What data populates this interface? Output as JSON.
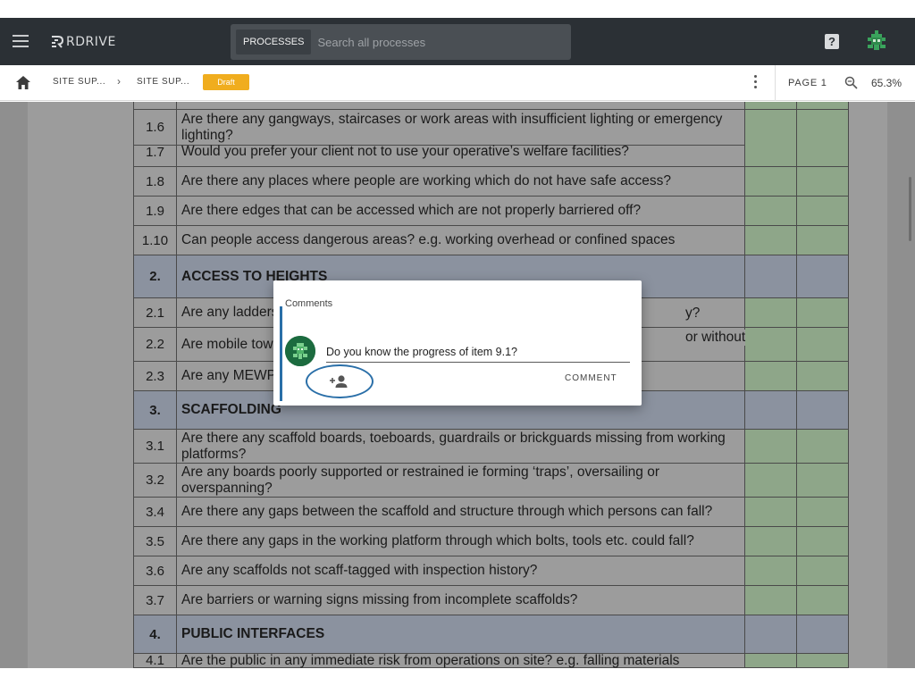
{
  "app": {
    "logo_text": "RDRIVE",
    "search": {
      "button_label": "PROCESSES",
      "placeholder": "Search all processes"
    },
    "help_label": "?"
  },
  "toolbar": {
    "breadcrumbs": [
      "SITE SUP...",
      "SITE SUP..."
    ],
    "separator": "›",
    "status_badge": "Draft",
    "page_label": "PAGE 1",
    "zoom": "65.3%"
  },
  "document": {
    "rows": [
      {
        "num": "",
        "text": "",
        "section": false
      },
      {
        "num": "1.6",
        "text": "Are there any gangways, staircases or work areas with insufficient lighting or emergency lighting?",
        "section": false
      },
      {
        "num": "1.7",
        "text": "Would you prefer your client not to use your operative’s welfare facilities?",
        "section": false
      },
      {
        "num": "1.8",
        "text": "Are there any places where people are working which do not have safe access?",
        "section": false
      },
      {
        "num": "1.9",
        "text": "Are there edges that can be accessed which are not properly barriered off?",
        "section": false
      },
      {
        "num": "1.10",
        "text": "Can people access dangerous areas? e.g. working overhead or confined spaces",
        "section": false
      },
      {
        "num": "2.",
        "text": "ACCESS TO HEIGHTS",
        "section": true
      },
      {
        "num": "2.1",
        "text": "Are any ladders to",
        "section": false
      },
      {
        "num": "2.2",
        "text": "Are mobile towers outriggers",
        "section": false
      },
      {
        "num": "2.3",
        "text": "Are any MEWP op",
        "section": false
      },
      {
        "num": "3.",
        "text": "SCAFFOLDING",
        "section": true
      },
      {
        "num": "3.1",
        "text": "Are there any scaffold boards, toeboards, guardrails or brickguards missing from working platforms?",
        "section": false
      },
      {
        "num": "3.2",
        "text": "Are any boards poorly supported or restrained ie forming ‘traps’, oversailing or overspanning?",
        "section": false
      },
      {
        "num": "3.4",
        "text": "Are there any gaps between the scaffold and structure through which persons can fall?",
        "section": false
      },
      {
        "num": "3.5",
        "text": "Are there any gaps in the working platform through which bolts, tools etc. could fall?",
        "section": false
      },
      {
        "num": "3.6",
        "text": "Are any scaffolds not scaff-tagged with inspection history?",
        "section": false
      },
      {
        "num": "3.7",
        "text": "Are barriers or warning signs missing from incomplete scaffolds?",
        "section": false
      },
      {
        "num": "4.",
        "text": "PUBLIC INTERFACES",
        "section": true
      },
      {
        "num": "4.1",
        "text": "Are the public in any immediate risk from operations on site? e.g. falling materials",
        "section": false
      }
    ],
    "partial_right_text": {
      "row_2_1": "y?",
      "row_2_2": "or without"
    }
  },
  "comments_dialog": {
    "title": "Comments",
    "comment_value": "Do you know the progress of item 9.1?",
    "submit_label": "COMMENT"
  },
  "colors": {
    "appbar": "#2b3035",
    "accent_blue": "#2a6fa8",
    "draft_badge": "#f0ad1e",
    "checkbox_green": "#8ea689",
    "section_gray": "#8b929f"
  },
  "icons": [
    "menu-icon",
    "logo-icon",
    "help-icon",
    "avatar-icon",
    "home-icon",
    "kebab-icon",
    "zoom-icon",
    "add-person-icon"
  ]
}
